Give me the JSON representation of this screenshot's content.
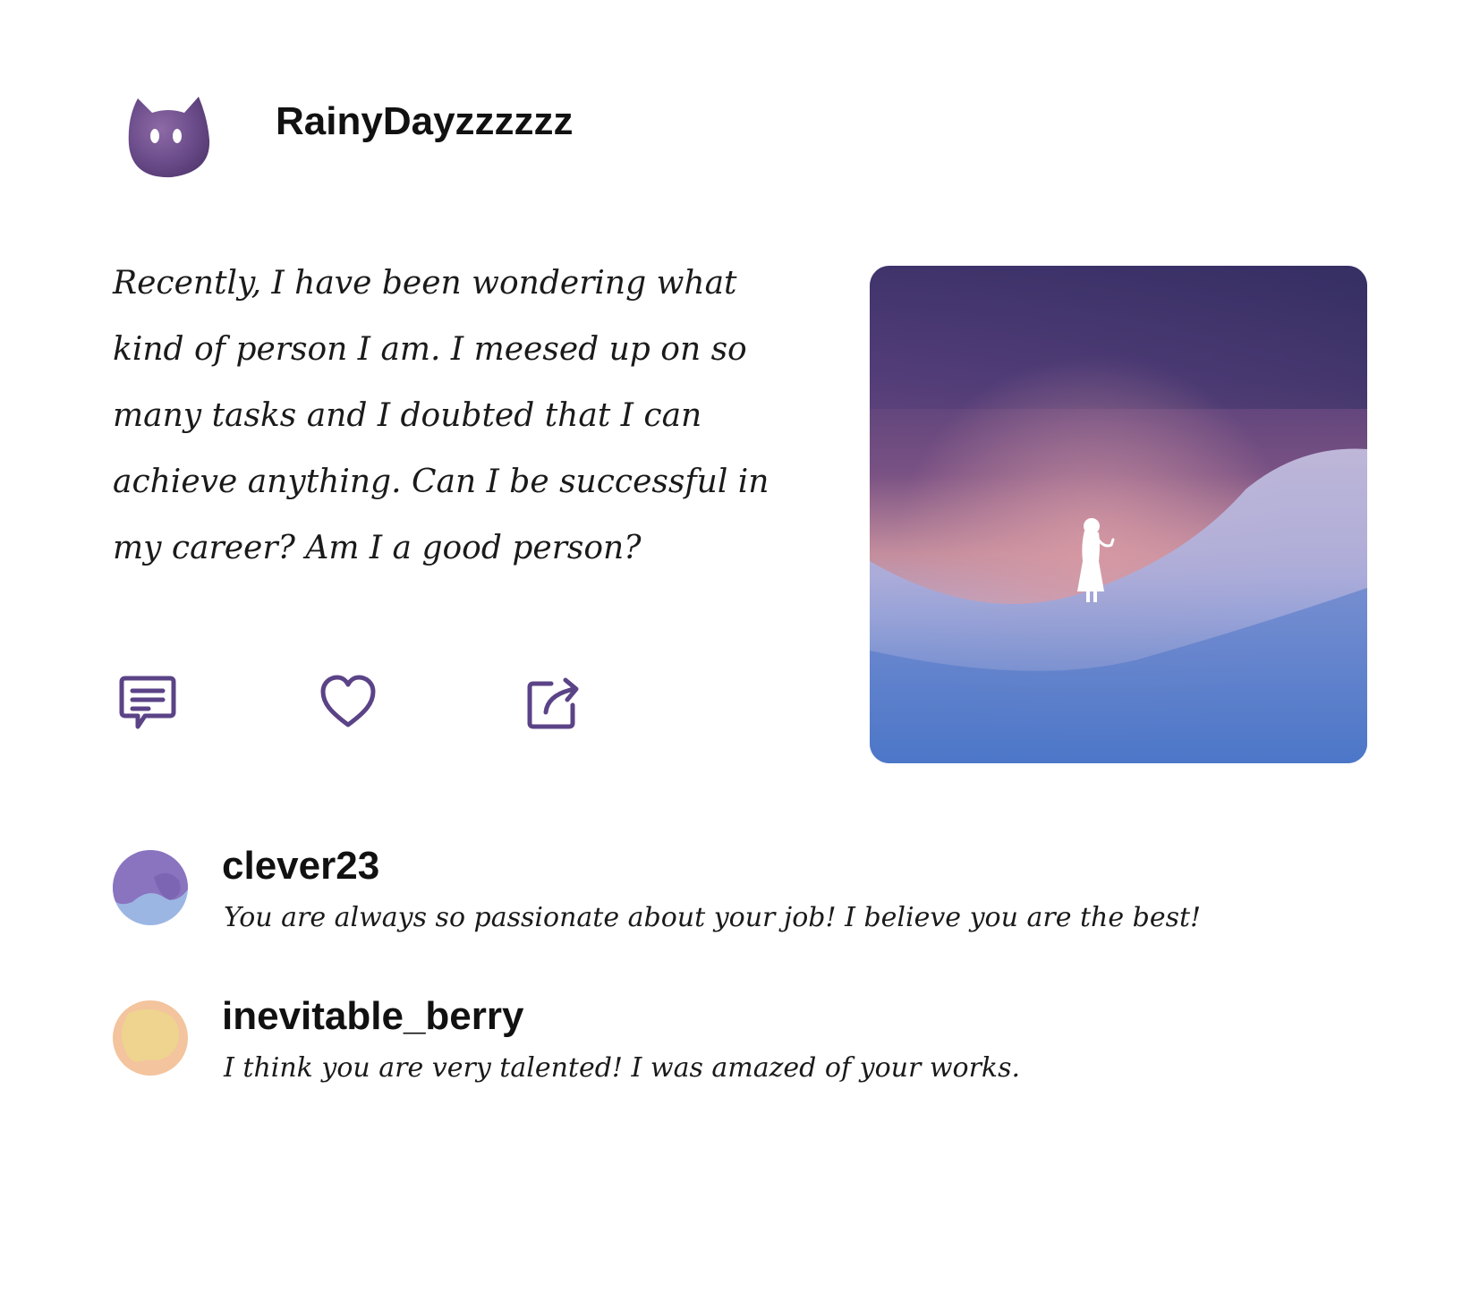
{
  "post": {
    "author": {
      "username": "RainyDayzzzzzz",
      "avatar_icon": "purple-cat-avatar"
    },
    "body": "Recently, I have been wondering what kind of person I am. I meesed up on so many tasks and I doubted that I can achieve anything. Can I be successful in my career? Am I a good person?",
    "image": {
      "icon": "girl-silhouette-night-sky-illustration",
      "colors": [
        "#3b3266",
        "#5b447c",
        "#c48e9e",
        "#b9b2d8",
        "#4a78c8"
      ]
    },
    "actions": [
      {
        "name": "comment",
        "icon": "comment-icon"
      },
      {
        "name": "like",
        "icon": "heart-icon"
      },
      {
        "name": "share",
        "icon": "share-icon"
      }
    ],
    "accent_color": "#5b4387"
  },
  "comments": [
    {
      "username": "clever23",
      "text": "You are always so passionate about your job! I believe you are the best!",
      "avatar_colors": [
        "#8a73bf",
        "#9cb6e4"
      ]
    },
    {
      "username": "inevitable_berry",
      "text": "I think you are very talented! I was amazed of your works.",
      "avatar_colors": [
        "#f3c49d",
        "#eed48f"
      ]
    }
  ]
}
